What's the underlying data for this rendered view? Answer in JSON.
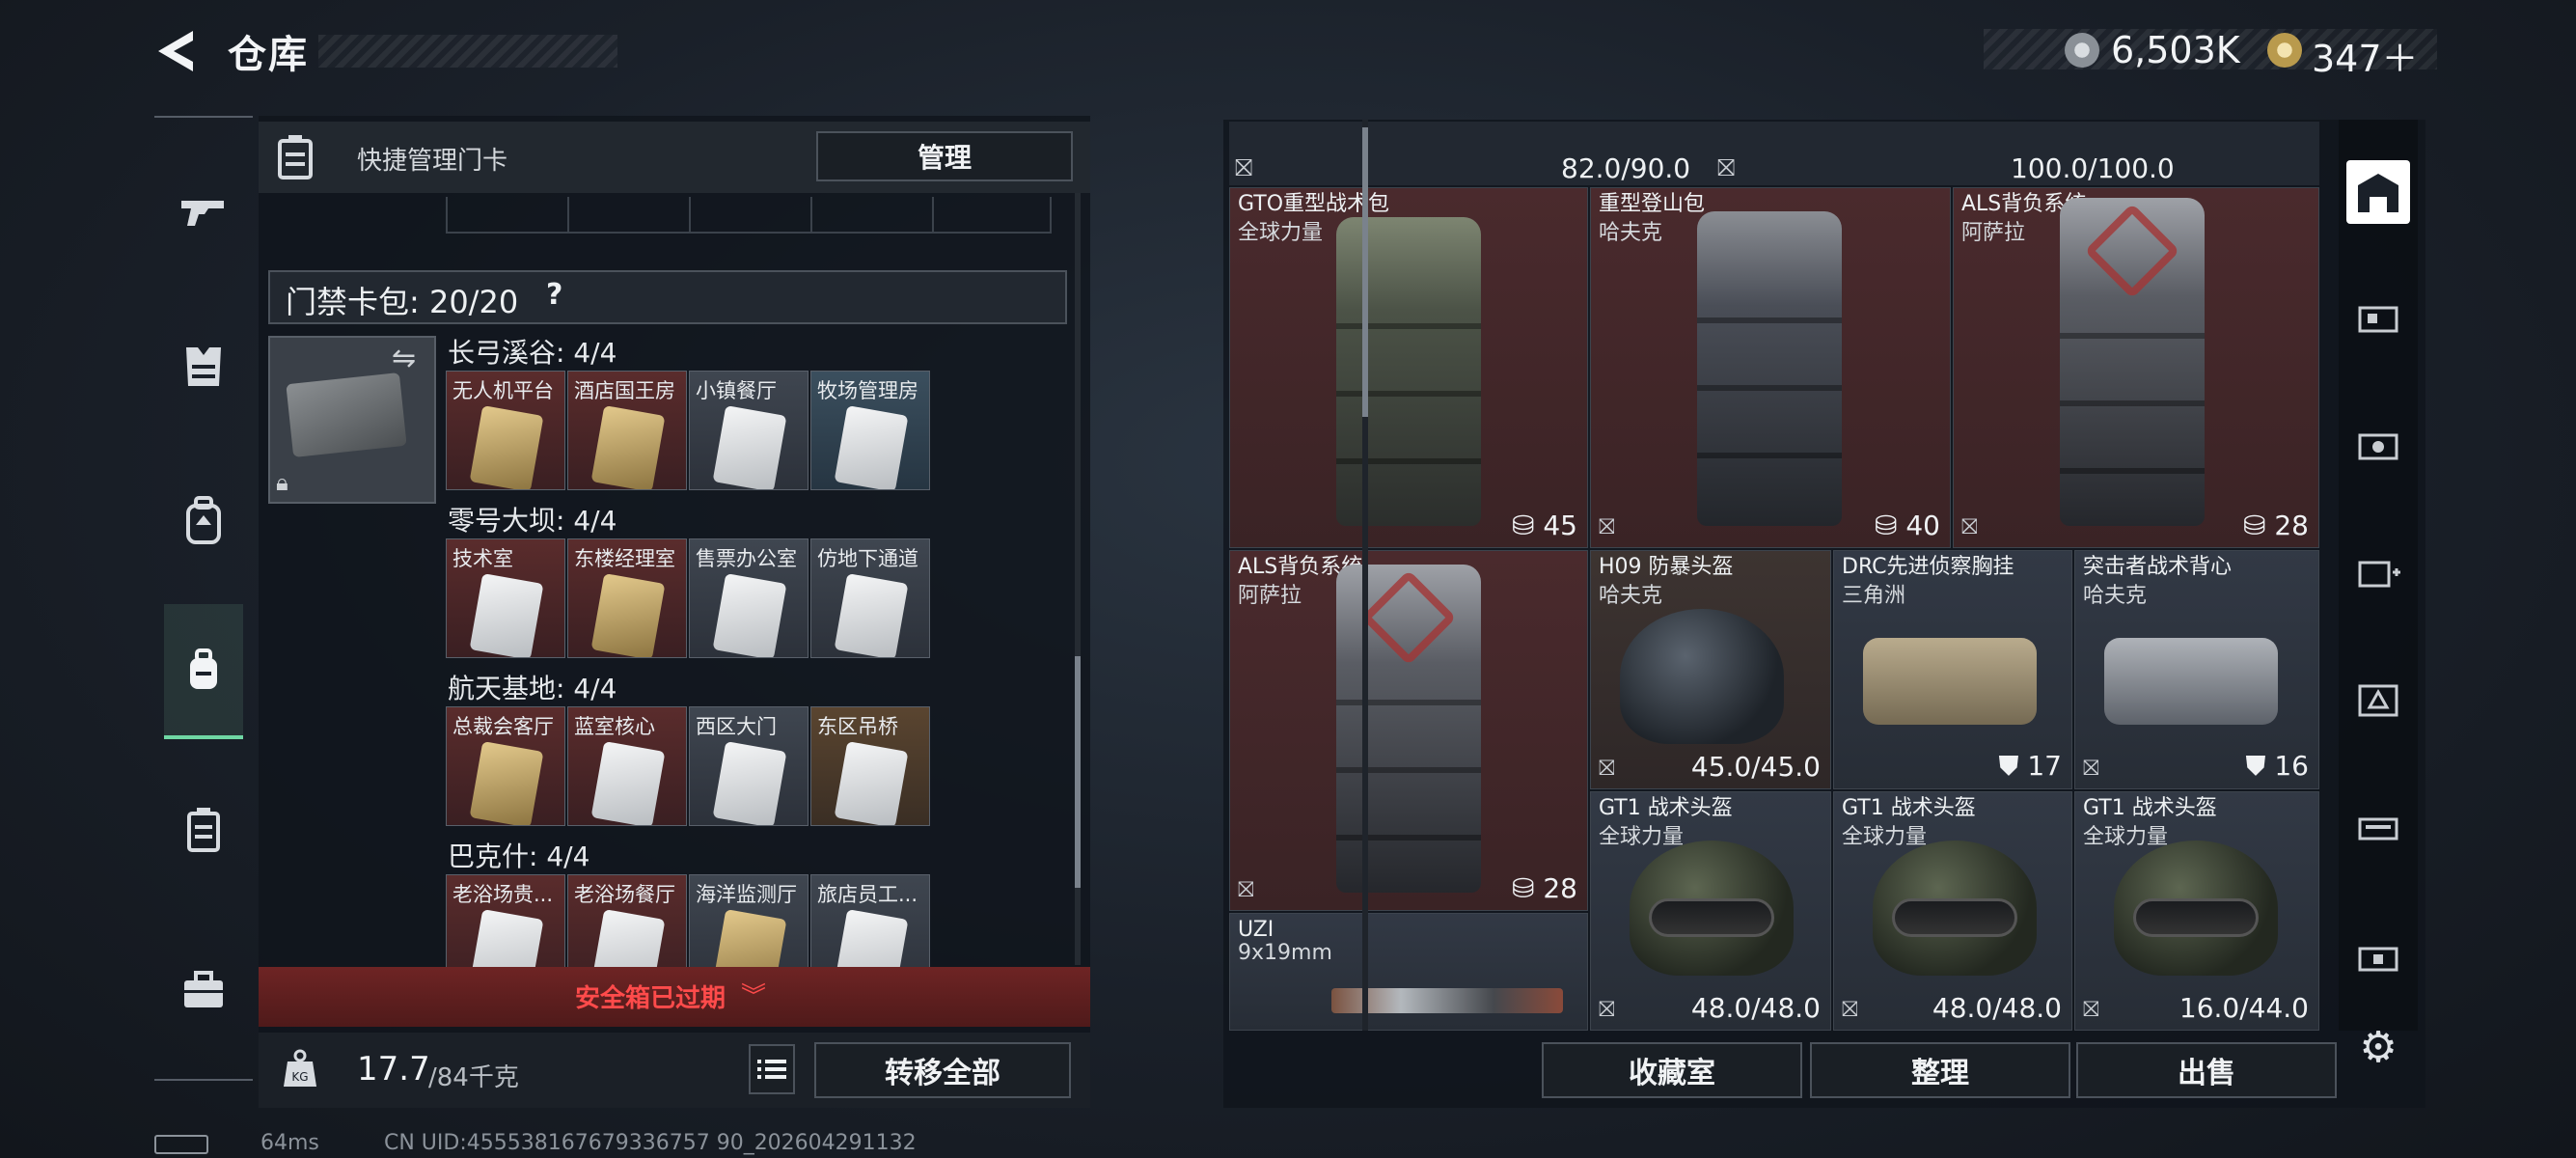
{
  "header": {
    "title": "仓库",
    "currency_1": "6,503K",
    "currency_2": "347＋"
  },
  "left_nav": [
    "gun-icon",
    "armor-icon",
    "backpack-icon",
    "backpack-active-icon",
    "card-case-icon",
    "toolbox-icon"
  ],
  "quick_manage": {
    "label": "快捷管理门卡",
    "button": "管理"
  },
  "keypack": {
    "label": "门禁卡包: 20/20",
    "help": "?"
  },
  "groups": [
    {
      "title": "长弓溪谷: 4/4",
      "cards": [
        {
          "label": "无人机平台",
          "style": "red",
          "gold": true
        },
        {
          "label": "酒店国王房",
          "style": "red",
          "gold": true
        },
        {
          "label": "小镇餐厅",
          "style": "gray",
          "gold": false
        },
        {
          "label": "牧场管理房",
          "style": "teal",
          "gold": false
        }
      ]
    },
    {
      "title": "零号大坝: 4/4",
      "cards": [
        {
          "label": "技术室",
          "style": "red",
          "gold": false
        },
        {
          "label": "东楼经理室",
          "style": "red",
          "gold": true
        },
        {
          "label": "售票办公室",
          "style": "gray",
          "gold": false
        },
        {
          "label": "仿地下通道",
          "style": "gray",
          "gold": false
        }
      ]
    },
    {
      "title": "航天基地: 4/4",
      "cards": [
        {
          "label": "总裁会客厅",
          "style": "red",
          "gold": true
        },
        {
          "label": "蓝室核心",
          "style": "red",
          "gold": false
        },
        {
          "label": "西区大门",
          "style": "gray",
          "gold": false
        },
        {
          "label": "东区吊桥",
          "style": "gold",
          "gold": false
        }
      ]
    },
    {
      "title": "巴克什: 4/4",
      "cards": [
        {
          "label": "老浴场贵...",
          "style": "red",
          "gold": false
        },
        {
          "label": "老浴场餐厅",
          "style": "red",
          "gold": false
        },
        {
          "label": "海洋监测厅",
          "style": "gray",
          "gold": true
        },
        {
          "label": "旅店员工...",
          "style": "gray",
          "gold": false
        }
      ]
    }
  ],
  "expired_notice": "安全箱已过期",
  "weight": {
    "current": "17.7",
    "max": "/84千克"
  },
  "transfer_all": "转移全部",
  "top_strip": {
    "val_1": "82.0/90.0",
    "val_2": "100.0/100.0"
  },
  "items": {
    "gto": {
      "name": "GTO重型战术包",
      "maker": "全球力量",
      "value": "45"
    },
    "heavy": {
      "name": "重型登山包",
      "maker": "哈夫克",
      "value": "40"
    },
    "als1": {
      "name": "ALS背负系统",
      "maker": "阿萨拉",
      "value": "28"
    },
    "als2": {
      "name": "ALS背负系统",
      "maker": "阿萨拉",
      "value": "28"
    },
    "h09": {
      "name": "H09 防暴头盔",
      "maker": "哈夫克",
      "value": "45.0/45.0"
    },
    "drc": {
      "name": "DRC先进侦察胸挂",
      "maker": "三角洲",
      "value": "17"
    },
    "assault": {
      "name": "突击者战术背心",
      "maker": "哈夫克",
      "value": "16"
    },
    "uzi": {
      "name": "UZI",
      "maker": "9x19mm"
    },
    "gt1a": {
      "name": "GT1 战术头盔",
      "maker": "全球力量",
      "value": "48.0/48.0"
    },
    "gt1b": {
      "name": "GT1 战术头盔",
      "maker": "全球力量",
      "value": "48.0/48.0"
    },
    "gt1c": {
      "name": "GT1 战术头盔",
      "maker": "全球力量",
      "value": "16.0/44.0"
    }
  },
  "actions": {
    "collection": "收藏室",
    "organize": "整理",
    "sell": "出售"
  },
  "status": {
    "ping": "64ms",
    "uid": "CN UID:455538167679336757 90_202604291132"
  }
}
